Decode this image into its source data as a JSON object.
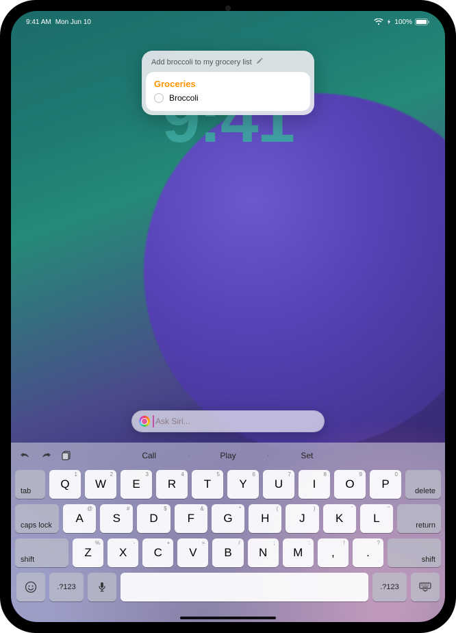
{
  "status": {
    "time": "9:41 AM",
    "date": "Mon Jun 10",
    "battery": "100%"
  },
  "lock_clock": "9:41",
  "siri_card": {
    "prompt": "Add broccoli to my grocery list",
    "list_title": "Groceries",
    "item": "Broccoli"
  },
  "siri_input": {
    "placeholder": "Ask Siri..."
  },
  "keyboard": {
    "suggestions": [
      "Call",
      "Play",
      "Set"
    ],
    "row1_hints": [
      "1",
      "2",
      "3",
      "4",
      "5",
      "6",
      "7",
      "8",
      "9",
      "0"
    ],
    "row1": [
      "Q",
      "W",
      "E",
      "R",
      "T",
      "Y",
      "U",
      "I",
      "O",
      "P"
    ],
    "row2_hints": [
      "@",
      "#",
      "$",
      "&",
      "*",
      "(",
      ")",
      "'",
      "\""
    ],
    "row2": [
      "A",
      "S",
      "D",
      "F",
      "G",
      "H",
      "J",
      "K",
      "L"
    ],
    "row3_hints": [
      "%",
      "-",
      "+",
      "=",
      "/",
      ";",
      ":",
      "!",
      "?"
    ],
    "row3": [
      "Z",
      "X",
      "C",
      "V",
      "B",
      "N",
      "M",
      ",",
      "."
    ],
    "labels": {
      "tab": "tab",
      "delete": "delete",
      "caps": "caps lock",
      "return": "return",
      "shift": "shift",
      "numbers": ".?123"
    }
  }
}
